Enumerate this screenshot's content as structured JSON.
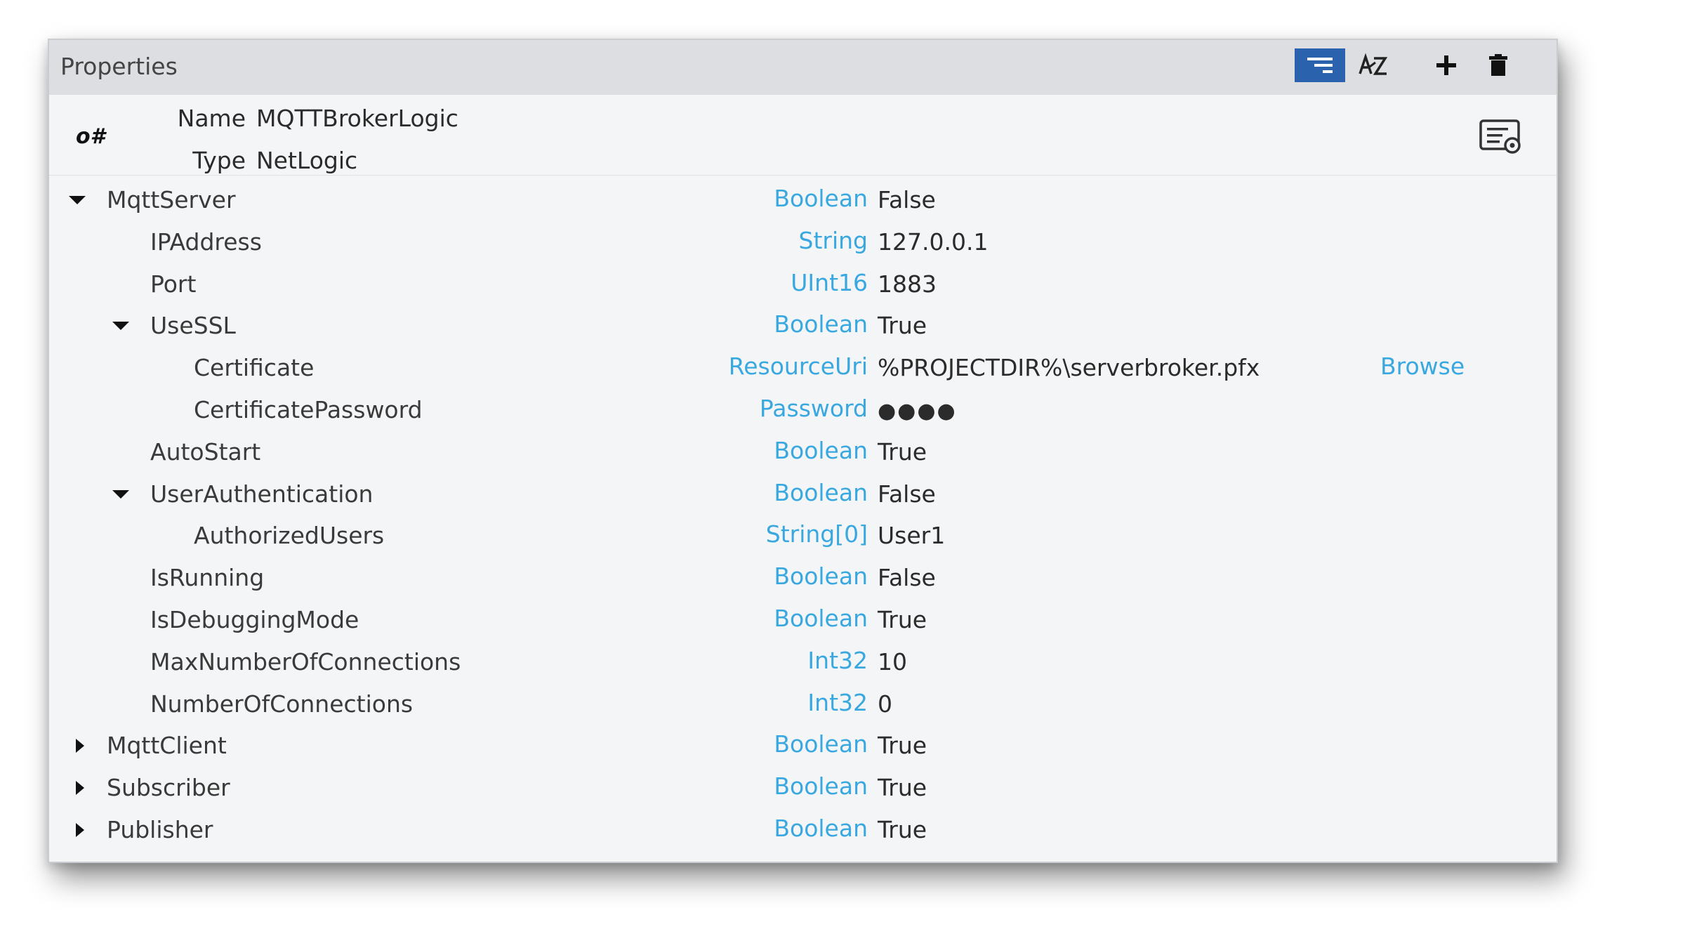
{
  "panel": {
    "title": "Properties",
    "toolbar": {
      "filter_icon": "filter-lines-icon",
      "sort_icon": "sort-az-icon",
      "add_icon": "plus-icon",
      "delete_icon": "trash-icon",
      "active_color": "#2a62ad"
    }
  },
  "header": {
    "icon_text": "o#",
    "name_label": "Name",
    "name_value": "MQTTBrokerLogic",
    "type_label": "Type",
    "type_value": "NetLogic",
    "settings_icon": "settings-panel-icon"
  },
  "colors": {
    "type_text": "#39a8e0",
    "link_text": "#39a8e0",
    "value_text": "#2b2b2b"
  },
  "rows": [
    {
      "name": "MqttServer",
      "type": "Boolean",
      "value": "False",
      "expanded": true
    },
    {
      "name": "IPAddress",
      "type": "String",
      "value": "127.0.0.1"
    },
    {
      "name": "Port",
      "type": "UInt16",
      "value": "1883"
    },
    {
      "name": "UseSSL",
      "type": "Boolean",
      "value": "True",
      "expanded": true
    },
    {
      "name": "Certificate",
      "type": "ResourceUri",
      "value": "%PROJECTDIR%\\serverbroker.pfx",
      "link": "Browse"
    },
    {
      "name": "CertificatePassword",
      "type": "Password",
      "value": "●●●●"
    },
    {
      "name": "AutoStart",
      "type": "Boolean",
      "value": "True"
    },
    {
      "name": "UserAuthentication",
      "type": "Boolean",
      "value": "False",
      "expanded": true
    },
    {
      "name": "AuthorizedUsers",
      "type": "String[0]",
      "value": "User1"
    },
    {
      "name": "IsRunning",
      "type": "Boolean",
      "value": "False"
    },
    {
      "name": "IsDebuggingMode",
      "type": "Boolean",
      "value": "True"
    },
    {
      "name": "MaxNumberOfConnections",
      "type": "Int32",
      "value": "10"
    },
    {
      "name": "NumberOfConnections",
      "type": "Int32",
      "value": "0"
    },
    {
      "name": "MqttClient",
      "type": "Boolean",
      "value": "True",
      "expanded": false
    },
    {
      "name": "Subscriber",
      "type": "Boolean",
      "value": "True",
      "expanded": false
    },
    {
      "name": "Publisher",
      "type": "Boolean",
      "value": "True",
      "expanded": false
    }
  ]
}
